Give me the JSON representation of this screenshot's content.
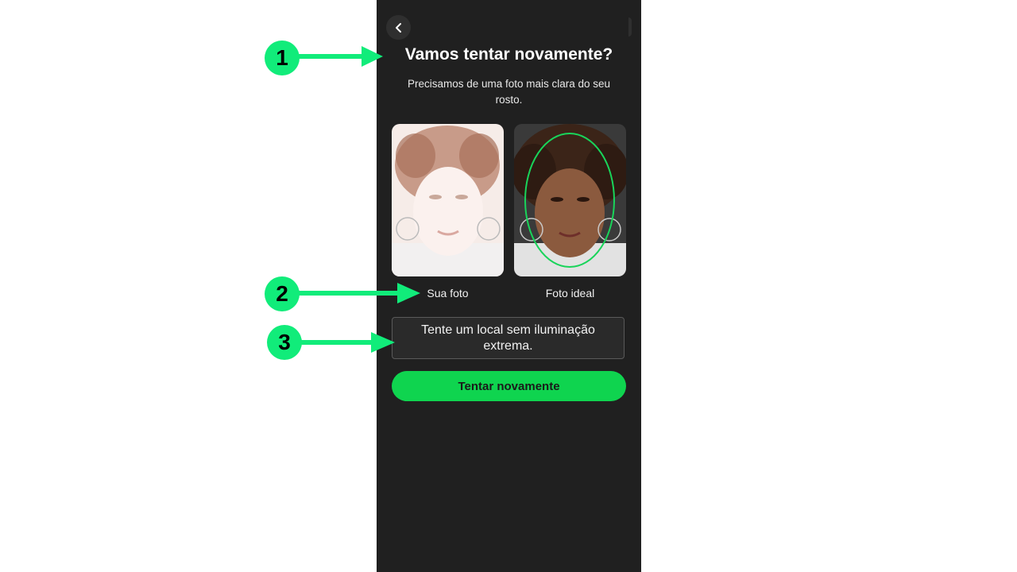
{
  "screen": {
    "title": "Vamos tentar novamente?",
    "subtitle": "Precisamos de uma foto mais clara do seu rosto.",
    "photos": [
      {
        "label": "Sua foto"
      },
      {
        "label": "Foto ideal"
      }
    ],
    "tip": "Tente um local sem iluminação extrema.",
    "retry_button": "Tentar novamente"
  },
  "callouts": [
    {
      "number": "1"
    },
    {
      "number": "2"
    },
    {
      "number": "3"
    }
  ],
  "colors": {
    "background": "#202020",
    "accent": "#0fd44f",
    "callout": "#11ec7a"
  },
  "icons": {
    "back": "chevron-left-icon"
  }
}
